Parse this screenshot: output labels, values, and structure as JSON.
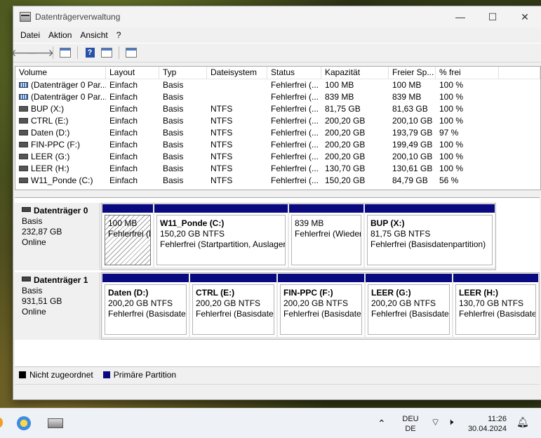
{
  "window": {
    "title": "Datenträgerverwaltung"
  },
  "window_buttons": {
    "minimize": "—",
    "maximize": "☐",
    "close": "✕"
  },
  "menu": [
    "Datei",
    "Aktion",
    "Ansicht",
    "?"
  ],
  "toolbar": {
    "help_label": "?"
  },
  "volume_list": {
    "columns": [
      "Volume",
      "Layout",
      "Typ",
      "Dateisystem",
      "Status",
      "Kapazität",
      "Freier Sp...",
      "% frei"
    ],
    "rows": [
      [
        "(Datenträger 0 Par...",
        "Einfach",
        "Basis",
        "",
        "Fehlerfrei (...",
        "100 MB",
        "100 MB",
        "100 %"
      ],
      [
        "(Datenträger 0 Par...",
        "Einfach",
        "Basis",
        "",
        "Fehlerfrei (...",
        "839 MB",
        "839 MB",
        "100 %"
      ],
      [
        "BUP (X:)",
        "Einfach",
        "Basis",
        "NTFS",
        "Fehlerfrei (...",
        "81,75 GB",
        "81,63 GB",
        "100 %"
      ],
      [
        "CTRL (E:)",
        "Einfach",
        "Basis",
        "NTFS",
        "Fehlerfrei (...",
        "200,20 GB",
        "200,10 GB",
        "100 %"
      ],
      [
        "Daten (D:)",
        "Einfach",
        "Basis",
        "NTFS",
        "Fehlerfrei (...",
        "200,20 GB",
        "193,79 GB",
        "97 %"
      ],
      [
        "FIN-PPC (F:)",
        "Einfach",
        "Basis",
        "NTFS",
        "Fehlerfrei (...",
        "200,20 GB",
        "199,49 GB",
        "100 %"
      ],
      [
        "LEER (G:)",
        "Einfach",
        "Basis",
        "NTFS",
        "Fehlerfrei (...",
        "200,20 GB",
        "200,10 GB",
        "100 %"
      ],
      [
        "LEER (H:)",
        "Einfach",
        "Basis",
        "NTFS",
        "Fehlerfrei (...",
        "130,70 GB",
        "130,61 GB",
        "100 %"
      ],
      [
        "W11_Ponde (C:)",
        "Einfach",
        "Basis",
        "NTFS",
        "Fehlerfrei (...",
        "150,20 GB",
        "84,79 GB",
        "56 %"
      ]
    ]
  },
  "disks": [
    {
      "title": "Datenträger 0",
      "type": "Basis",
      "size": "232,87 GB",
      "status": "Online",
      "partitions": [
        {
          "name": "",
          "size": "100 MB",
          "status": "Fehlerfrei (E"
        },
        {
          "name": "W11_Ponde  (C:)",
          "size": "150,20 GB NTFS",
          "status": "Fehlerfrei (Startpartition, Auslager"
        },
        {
          "name": "",
          "size": "839 MB",
          "status": "Fehlerfrei (Wieder"
        },
        {
          "name": "BUP  (X:)",
          "size": "81,75 GB NTFS",
          "status": "Fehlerfrei (Basisdatenpartition)"
        }
      ]
    },
    {
      "title": "Datenträger 1",
      "type": "Basis",
      "size": "931,51 GB",
      "status": "Online",
      "partitions": [
        {
          "name": "Daten  (D:)",
          "size": "200,20 GB NTFS",
          "status": "Fehlerfrei (Basisdater"
        },
        {
          "name": "CTRL  (E:)",
          "size": "200,20 GB NTFS",
          "status": "Fehlerfrei (Basisdater"
        },
        {
          "name": "FIN-PPC  (F:)",
          "size": "200,20 GB NTFS",
          "status": "Fehlerfrei (Basisdater"
        },
        {
          "name": "LEER  (G:)",
          "size": "200,20 GB NTFS",
          "status": "Fehlerfrei (Basisdater"
        },
        {
          "name": "LEER  (H:)",
          "size": "130,70 GB NTFS",
          "status": "Fehlerfrei (Basisdate"
        }
      ]
    }
  ],
  "legend": [
    {
      "label": "Nicht zugeordnet",
      "color": "#000000"
    },
    {
      "label": "Primäre Partition",
      "color": "#0a0a80"
    }
  ],
  "taskbar": {
    "language": "DEU",
    "language_sub": "DE",
    "time": "11:26",
    "date": "30.04.2024"
  }
}
